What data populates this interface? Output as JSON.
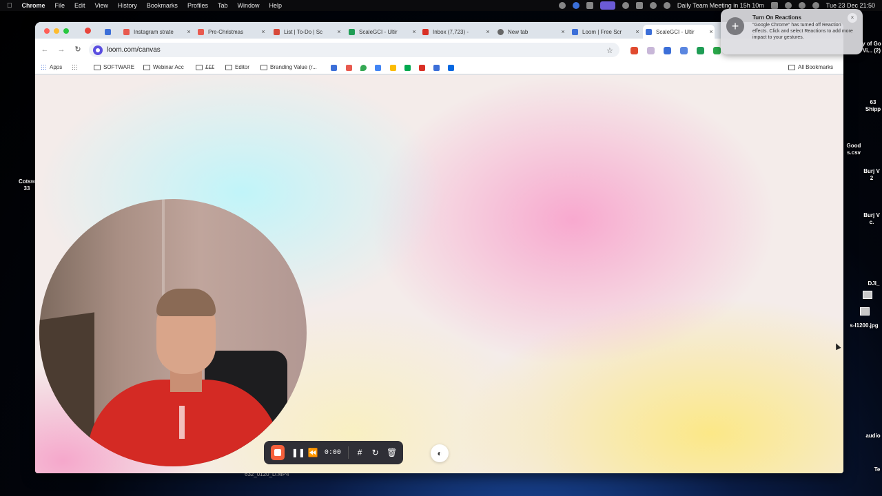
{
  "menubar": {
    "app": "Chrome",
    "items": [
      "File",
      "Edit",
      "View",
      "History",
      "Bookmarks",
      "Profiles",
      "Tab",
      "Window",
      "Help"
    ],
    "calendar": "Daily Team Meeting in 15h 10m",
    "datetime": "Tue 23 Dec  21:50"
  },
  "notification": {
    "title": "Turn On Reactions",
    "body": "\"Google Chrome\" has turned off Reaction effects. Click and select Reactions to add more impact to your gestures."
  },
  "tabs": [
    {
      "title": "",
      "favicon": "#3c6fd8"
    },
    {
      "title": "Instagram strate",
      "favicon": "#e85a4f"
    },
    {
      "title": "Pre-Christmas",
      "favicon": "#e85a4f"
    },
    {
      "title": "List | To-Do | Sc",
      "favicon": "#d84a3a"
    },
    {
      "title": "ScaleGCI - Ultir",
      "favicon": "#1f9d55"
    },
    {
      "title": "Inbox (7,723) -",
      "favicon": "#d93025"
    },
    {
      "title": "New tab",
      "favicon": "#666666"
    },
    {
      "title": "Loom | Free Scr",
      "favicon": "#3c6fd8"
    },
    {
      "title": "ScaleGCI - Ultir",
      "favicon": "#3c6fd8"
    }
  ],
  "address": {
    "url": "loom.com/canvas"
  },
  "bookmarks": {
    "apps": "Apps",
    "folders": [
      "SOFTWARE",
      "Webinar Acc",
      "£££",
      "Editor",
      "Branding Value (r..."
    ],
    "all": "All Bookmarks"
  },
  "recorder": {
    "timer": "0:00"
  },
  "desktop": {
    "items": [
      "Cotsw",
      "33",
      "Good",
      "s.csv",
      "Burj V",
      "2",
      "Burj V",
      "c.",
      "DJI_",
      "s-l1200.jpg",
      "audio",
      "Te",
      "y of Go",
      "Vi... (2)",
      "63",
      "Shipp"
    ],
    "file_label": "632_0120_D.MP4"
  },
  "colors": {
    "accent": "#5a4ee0",
    "record": "#f5603c"
  }
}
